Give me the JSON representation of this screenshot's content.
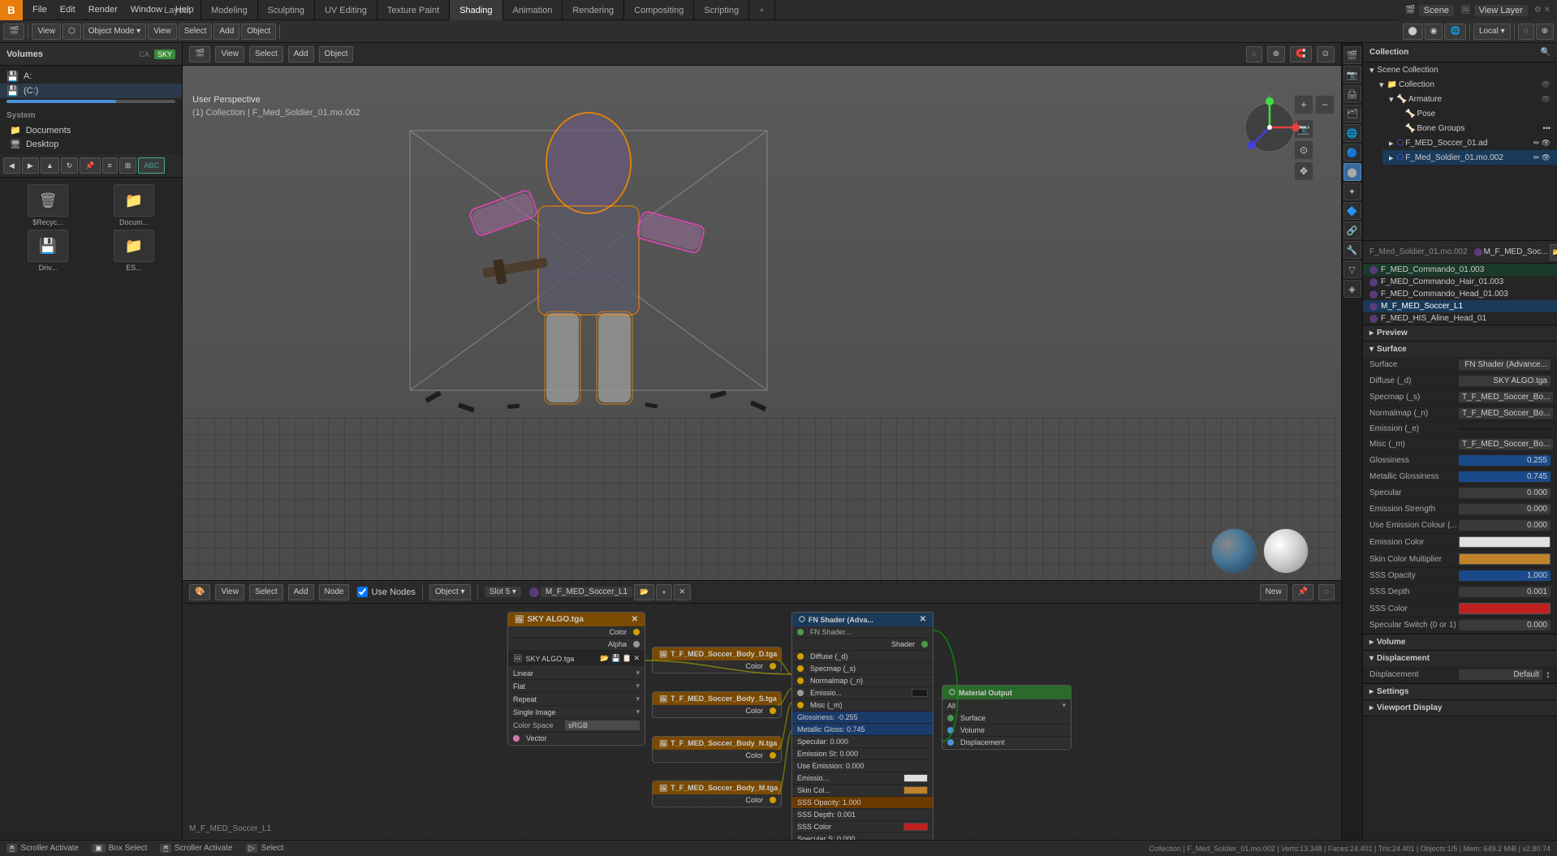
{
  "app": {
    "title": "Blender"
  },
  "topMenu": {
    "logo": "B",
    "items": [
      "File",
      "Edit",
      "Render",
      "Window",
      "Help"
    ]
  },
  "workspaceTabs": [
    {
      "label": "Layout",
      "active": false
    },
    {
      "label": "Modeling",
      "active": false
    },
    {
      "label": "Sculpting",
      "active": false
    },
    {
      "label": "UV Editing",
      "active": false
    },
    {
      "label": "Texture Paint",
      "active": false
    },
    {
      "label": "Shading",
      "active": true
    },
    {
      "label": "Animation",
      "active": false
    },
    {
      "label": "Rendering",
      "active": false
    },
    {
      "label": "Compositing",
      "active": false
    },
    {
      "label": "Scripting",
      "active": false
    }
  ],
  "topRight": {
    "scene_label": "Scene",
    "viewlayer_label": "View Layer"
  },
  "viewport": {
    "mode": "Object Mode",
    "perspective": "User Perspective",
    "collection": "(1) Collection | F_Med_Soldier_01.mo.002",
    "shading_label": "Local",
    "view_button": "View",
    "select_button": "Select",
    "add_button": "Add",
    "object_button": "Object"
  },
  "outliner": {
    "title": "Collection",
    "items": [
      {
        "label": "Scene Collection",
        "indent": 0,
        "icon": "🔷"
      },
      {
        "label": "Collection",
        "indent": 1,
        "icon": "📁"
      },
      {
        "label": "Armature",
        "indent": 2,
        "icon": "🦴"
      },
      {
        "label": "Pose",
        "indent": 3,
        "icon": "🦴"
      },
      {
        "label": "Bone Groups",
        "indent": 3,
        "icon": "🦴"
      },
      {
        "label": "F_MED_Soccer_01.ad",
        "indent": 2,
        "icon": "▸"
      },
      {
        "label": "F_Med_Soldier_01.mo.002",
        "indent": 2,
        "icon": "▸",
        "selected": true
      },
      {
        "label": "F_Med_Soldier_01.mo.002",
        "indent": 2,
        "icon": "👁"
      }
    ]
  },
  "materialsList": {
    "items": [
      {
        "label": "F_MED_Commando_01.003",
        "color": "#5a3a7a"
      },
      {
        "label": "F_MED_Commando_Hair_01.003",
        "color": "#5a3a7a"
      },
      {
        "label": "F_MED_Commando_Head_01.003",
        "color": "#5a3a7a"
      },
      {
        "label": "M_F_MED_Soccer_L1",
        "color": "#5a3a7a",
        "selected": true
      },
      {
        "label": "F_MED_HIS_Aline_Head_01",
        "color": "#5a3a7a"
      }
    ]
  },
  "properties": {
    "object_name": "F_Med_Soldier_01.mo.002",
    "material_name": "M_F_MED_Soc...",
    "data_tab": "Data",
    "surface_section": {
      "label": "Surface",
      "shader": "FN Shader (Advance...",
      "diffuse": "SKY ALGO.tga",
      "specmap": "T_F_MED_Soccer_Bo...",
      "normalmap": "T_F_MED_Soccer_Bo...",
      "emission_e": "",
      "misc_m": "T_F_MED_Soccer_Bo...",
      "glossiness": "0.255",
      "metallic_glossiness": "0.745",
      "specular": "0.000",
      "emission_strength": "0.000",
      "use_emission_color": "0.000",
      "emission_color": "white",
      "skin_color_multiplier": "orange",
      "sss_opacity": "1.000",
      "sss_depth": "0.001",
      "sss_color": "red",
      "specular_switch": "0.000"
    }
  },
  "shaderEditor": {
    "header": {
      "object_btn": "Object",
      "view_btn": "View",
      "select_btn": "Select",
      "add_btn": "Add",
      "node_btn": "Node",
      "use_nodes": "Use Nodes",
      "slot": "Slot 5",
      "material": "M_F_MED_Soccer_L1",
      "new_btn": "New"
    },
    "nodes": {
      "sky_algo": {
        "title": "SKY ALGO.tga",
        "filename": "SKY ALGO.tga",
        "outputs": [
          "Color",
          "Alpha"
        ],
        "settings": [
          "Linear",
          "Flat",
          "Repeat",
          "Single Image"
        ],
        "color_space": "sRGB",
        "vector": "Vector"
      },
      "fn_shader": {
        "title": "FN Shader (Adva...",
        "inputs": [
          {
            "label": "FN Shader...",
            "socket": "orange"
          },
          {
            "label": "Shader",
            "socket": "green"
          },
          {
            "label": "Diffuse (_d)",
            "socket": "yellow"
          },
          {
            "label": "Specmap (_s)",
            "socket": "yellow"
          },
          {
            "label": "Normalmap (_n)",
            "socket": "yellow"
          },
          {
            "label": "Emissio...",
            "socket": "gray"
          },
          {
            "label": "Misc (_m)",
            "socket": "yellow"
          },
          {
            "label": "Glossiness: -0.255",
            "value": "-0.255",
            "highlight": "blue"
          },
          {
            "label": "Metallic Gloss: 0.745",
            "value": "0.745",
            "highlight": "blue"
          },
          {
            "label": "Specular: 0.000",
            "value": "0.000"
          },
          {
            "label": "Emission St: 0.000",
            "value": "0.000"
          },
          {
            "label": "Use Emission: 0.000",
            "value": "0.000"
          },
          {
            "label": "Emissio...",
            "value": "white"
          },
          {
            "label": "Skin Col...",
            "value": "orange"
          },
          {
            "label": "SSS Opacity: 1.000",
            "value": "1.000",
            "highlight": "orange"
          },
          {
            "label": "SSS Depth: 0.001",
            "value": "0.001"
          },
          {
            "label": "SSS Color",
            "value": "red"
          },
          {
            "label": "Specular S: 0.000",
            "value": "0.000"
          }
        ]
      },
      "texture_nodes": [
        {
          "title": "T_F_MED_Soccer_Body_D.tga"
        },
        {
          "title": "T_F_MED_Soccer_Body_S.tga"
        },
        {
          "title": "T_F_MED_Soccer_Body_N.tga"
        },
        {
          "title": "T_F_MED_Soccer_Body_M.tga"
        }
      ],
      "material_output": {
        "title": "Material Output",
        "type": "All",
        "outputs": [
          "Surface",
          "Volume",
          "Displacement"
        ]
      }
    }
  },
  "statusBar": {
    "items": [
      {
        "key": "Scroller Activate",
        "label": "Scroller Activate"
      },
      {
        "key": "Box Select",
        "label": "Box Select"
      },
      {
        "key": "Scroller Activate",
        "label": "Scroller Activate"
      },
      {
        "key": "Select",
        "label": "Select"
      }
    ],
    "right": "Collection | F_Med_Soldier_01.mo.002 | Verts:13.348 | Faces:24.401 | Tris:24.401 | Objects:1/5 | Mem: 649.2 MiB | v2.80.74"
  },
  "icons": {
    "triangle": "▶",
    "folder": "📁",
    "bone": "🦴",
    "eye": "👁",
    "mesh": "⬡",
    "camera": "📷",
    "light": "💡",
    "material": "⬤",
    "chevron_down": "▾",
    "chevron_right": "▸",
    "close": "✕",
    "plus": "+",
    "minus": "−",
    "dot": "●",
    "check": "✓"
  }
}
